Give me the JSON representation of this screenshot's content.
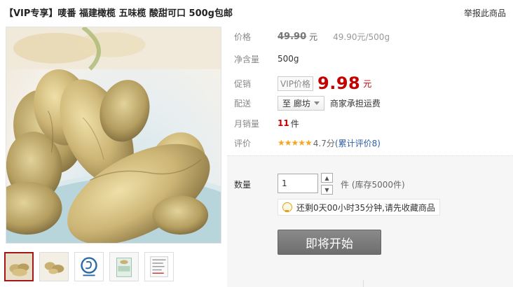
{
  "product": {
    "title": "【VIP专享】唛番 福建橄榄 五味榄 酸甜可口 500g包邮",
    "report_link": "举报此商品"
  },
  "price": {
    "label": "价格",
    "original": "49.90",
    "yuan": "元",
    "unit_price": "49.90元/500g"
  },
  "net_weight": {
    "label": "净含量",
    "value": "500g"
  },
  "promo": {
    "label": "促销",
    "vip_badge": "VIP价格",
    "price": "9.98",
    "yuan": "元"
  },
  "shipping": {
    "label": "配送",
    "destination": "至 廊坊",
    "note": "商家承担运费"
  },
  "monthly_sales": {
    "label": "月销量",
    "count": "11",
    "unit": "件"
  },
  "rating": {
    "label": "评价",
    "stars": "★★★★★",
    "score": "4.7分",
    "reviews_link": "(累计评价8)"
  },
  "purchase": {
    "qty_label": "数量",
    "qty_value": "1",
    "qty_unit_stock": "件 (库存5000件)",
    "notice": "还剩0天00小时35分钟,请先收藏商品",
    "cta_label": "即将开始"
  },
  "colors": {
    "accent": "#c40000",
    "link": "#2f5fa6",
    "star": "#f5a623",
    "thumb_active_border": "#a01818"
  }
}
